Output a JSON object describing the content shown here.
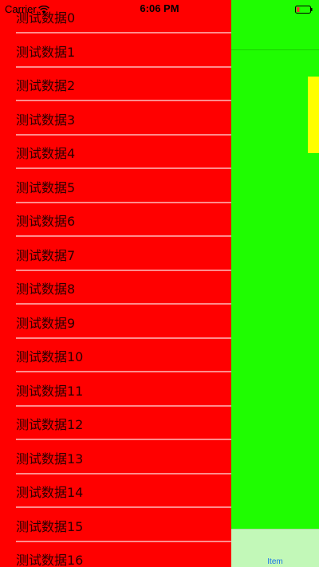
{
  "status_bar": {
    "carrier": "Carrier",
    "time": "6:06 PM",
    "battery_color": "#ff2d2d"
  },
  "colors": {
    "menu_background": "#ff0000",
    "content_background": "#1ffd01",
    "accent_block": "#ffff00",
    "tab_bar": "#c2f8b8",
    "tab_tint": "#1a73e8"
  },
  "menu": {
    "items": [
      {
        "label": "测试数据0"
      },
      {
        "label": "测试数据1"
      },
      {
        "label": "测试数据2"
      },
      {
        "label": "测试数据3"
      },
      {
        "label": "测试数据4"
      },
      {
        "label": "测试数据5"
      },
      {
        "label": "测试数据6"
      },
      {
        "label": "测试数据7"
      },
      {
        "label": "测试数据8"
      },
      {
        "label": "测试数据9"
      },
      {
        "label": "测试数据10"
      },
      {
        "label": "测试数据11"
      },
      {
        "label": "测试数据12"
      },
      {
        "label": "测试数据13"
      },
      {
        "label": "测试数据14"
      },
      {
        "label": "测试数据15"
      },
      {
        "label": "测试数据16"
      }
    ]
  },
  "tab_bar": {
    "item_label": "Item"
  }
}
